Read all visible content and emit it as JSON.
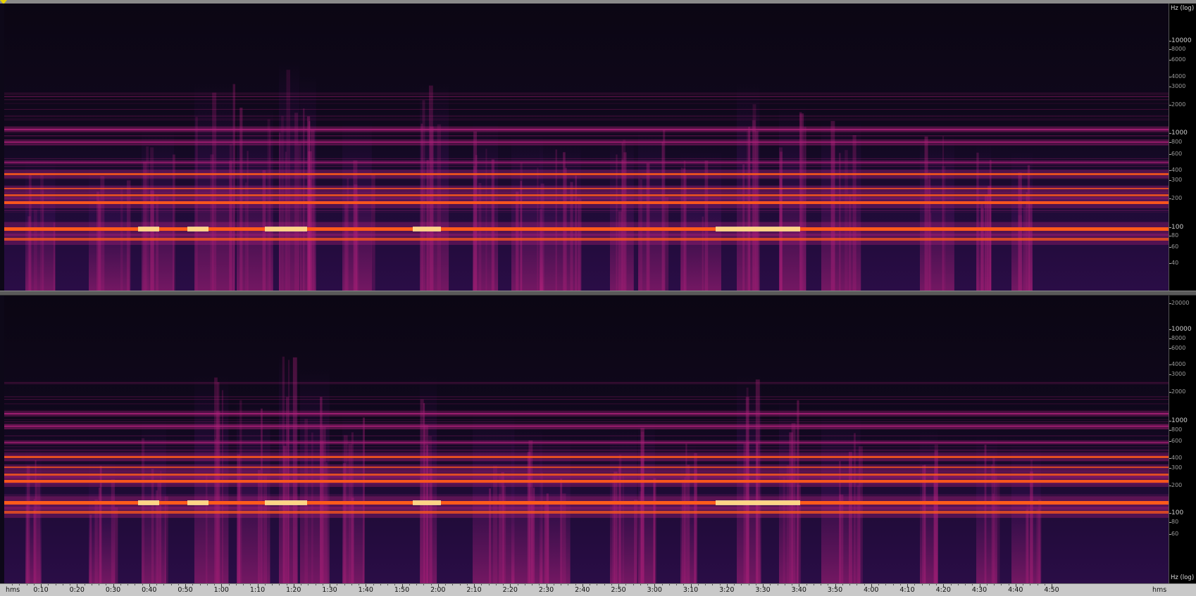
{
  "yaxis_top": {
    "unit": "Hz (log)",
    "ticks": [
      {
        "label": "10000",
        "major": true
      },
      {
        "label": "8000",
        "major": false
      },
      {
        "label": "6000",
        "major": false
      },
      {
        "label": "4000",
        "major": false
      },
      {
        "label": "3000",
        "major": false
      },
      {
        "label": "2000",
        "major": false
      },
      {
        "label": "1000",
        "major": true
      },
      {
        "label": "800",
        "major": false
      },
      {
        "label": "600",
        "major": false
      },
      {
        "label": "400",
        "major": false
      },
      {
        "label": "300",
        "major": false
      },
      {
        "label": "200",
        "major": false
      },
      {
        "label": "100",
        "major": true
      },
      {
        "label": "80",
        "major": false
      },
      {
        "label": "60",
        "major": false
      },
      {
        "label": "40",
        "major": false
      }
    ]
  },
  "yaxis_bottom": {
    "unit": "Hz (log)",
    "ticks": [
      {
        "label": "20000",
        "major": false
      },
      {
        "label": "10000",
        "major": true
      },
      {
        "label": "8000",
        "major": false
      },
      {
        "label": "6000",
        "major": false
      },
      {
        "label": "4000",
        "major": false
      },
      {
        "label": "3000",
        "major": false
      },
      {
        "label": "2000",
        "major": false
      },
      {
        "label": "1000",
        "major": true
      },
      {
        "label": "800",
        "major": false
      },
      {
        "label": "600",
        "major": false
      },
      {
        "label": "400",
        "major": false
      },
      {
        "label": "300",
        "major": false
      },
      {
        "label": "200",
        "major": false
      },
      {
        "label": "100",
        "major": true
      },
      {
        "label": "80",
        "major": false
      },
      {
        "label": "60",
        "major": false
      }
    ]
  },
  "time_axis": {
    "unit_left": "hms",
    "unit_right": "hms",
    "ticks": [
      "0:10",
      "0:20",
      "0:30",
      "0:40",
      "0:50",
      "1:00",
      "1:10",
      "1:20",
      "1:30",
      "1:40",
      "1:50",
      "2:00",
      "2:10",
      "2:20",
      "2:30",
      "2:40",
      "2:50",
      "3:00",
      "3:10",
      "3:20",
      "3:30",
      "3:40",
      "3:50",
      "4:00",
      "4:10",
      "4:20",
      "4:30",
      "4:40",
      "4:50"
    ]
  },
  "colors": {
    "background": "#0c0716",
    "low": "#3a0f55",
    "mid": "#b0207a",
    "high": "#ff5a1a",
    "peak": "#fff2a0"
  }
}
